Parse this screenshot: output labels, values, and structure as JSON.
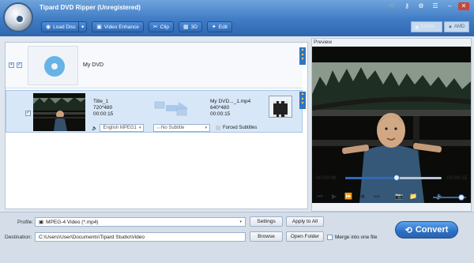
{
  "app": {
    "title": "Tipard DVD Ripper (Unregistered)"
  },
  "window_icons": [
    "cart-icon",
    "key-icon",
    "settings-icon",
    "menu-icon",
    "minimize-icon",
    "close-icon"
  ],
  "toolbar": {
    "load_disc": "Load Disc",
    "video_enhance": "Video Enhance",
    "clip": "Clip",
    "three_d": "3D",
    "edit": "Edit",
    "cuda": "CUDA",
    "amd": "AMD"
  },
  "dvd": {
    "name": "My DVD"
  },
  "title_item": {
    "source": {
      "name": "Title_1",
      "resolution": "720*480",
      "duration": "00:00:15"
    },
    "output": {
      "name": "My DVD..._1.mp4",
      "resolution": "640*480",
      "duration": "00:00:15"
    },
    "audio_track": "English MPEG1",
    "subtitle": "No Subtitle",
    "forced_subtitles": "Forced Subtitles",
    "badge_2d": "2D"
  },
  "preview": {
    "label": "Preview",
    "current_time": "00:00:08",
    "total_time": "00:00:15",
    "progress": 0.53,
    "volume": 0.85
  },
  "bottom": {
    "profile_label": "Profile:",
    "profile_value": "MPEG-4 Video (*.mp4)",
    "settings": "Settings",
    "apply_to_all": "Apply to All",
    "destination_label": "Destination:",
    "destination_value": "C:\\Users\\User\\Documents\\Tipard Studio\\Video",
    "browse": "Browse",
    "open_folder": "Open Folder",
    "merge_label": "Merge into one file",
    "convert": "Convert"
  },
  "colors": {
    "accent": "#2f6ab5",
    "titlebar": "#3f7bc4",
    "selected_row": "#d7e7f7"
  }
}
